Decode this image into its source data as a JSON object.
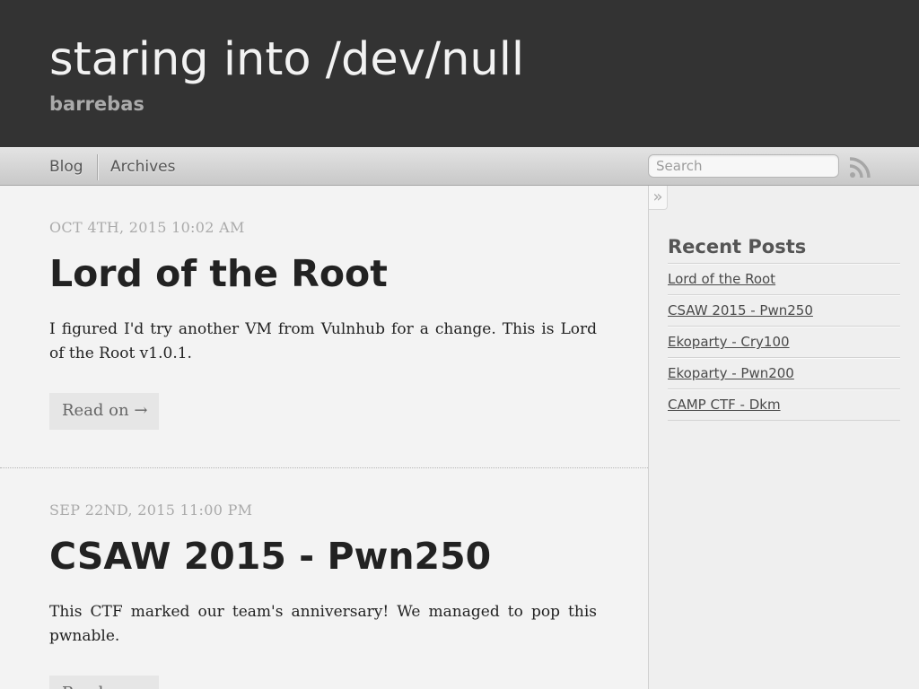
{
  "header": {
    "title": "staring into /dev/null",
    "subtitle": "barrebas"
  },
  "nav": {
    "items": [
      {
        "label": "Blog"
      },
      {
        "label": "Archives"
      }
    ],
    "search_placeholder": "Search",
    "rss_icon": "rss-icon"
  },
  "posts": [
    {
      "date": "OCT 4TH, 2015 10:02 AM",
      "title": "Lord of the Root",
      "excerpt": "I figured I'd try another VM from Vulnhub for a change. This is Lord of the Root v1.0.1.",
      "read_on": "Read on →"
    },
    {
      "date": "SEP 22ND, 2015 11:00 PM",
      "title": "CSAW 2015 - Pwn250",
      "excerpt": "This CTF marked our team's anniversary! We managed to pop this pwnable.",
      "read_on": "Read on →"
    }
  ],
  "sidebar": {
    "toggle_glyph": "»",
    "heading": "Recent Posts",
    "recent": [
      {
        "label": "Lord of the Root"
      },
      {
        "label": "CSAW 2015 - Pwn250"
      },
      {
        "label": "Ekoparty - Cry100"
      },
      {
        "label": "Ekoparty - Pwn200"
      },
      {
        "label": "CAMP CTF - Dkm"
      }
    ]
  },
  "colors": {
    "header_bg": "#333333",
    "page_bg": "#f3f3f3",
    "title_text": "#222222",
    "date_text": "#aaaaaa"
  }
}
